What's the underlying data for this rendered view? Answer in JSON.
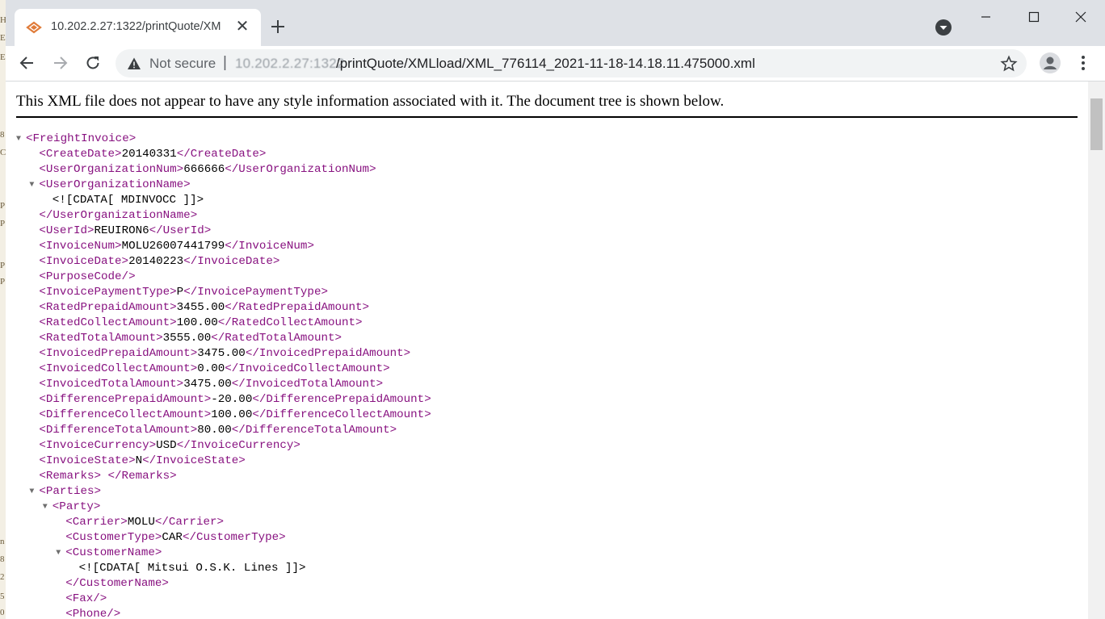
{
  "tab": {
    "title": "10.202.2.27:1322/printQuote/XM"
  },
  "address": {
    "security": "Not secure",
    "host": "10.202.2.27:1322",
    "path": "/printQuote/XMLload/XML_776114_2021-11-18-14.18.11.475000.xml"
  },
  "notice": "This XML file does not appear to have any style information associated with it. The document tree is shown below.",
  "bg_strip": [
    "H",
    "E",
    "E",
    "8",
    "C",
    "P",
    "P",
    "P",
    "P",
    "n",
    "8",
    "2",
    "5",
    "0"
  ],
  "xml_lines": [
    {
      "indent": 0,
      "toggle": true,
      "open": "<FreightInvoice>",
      "text": "",
      "close": ""
    },
    {
      "indent": 1,
      "toggle": false,
      "open": "<CreateDate>",
      "text": "20140331",
      "close": "</CreateDate>"
    },
    {
      "indent": 1,
      "toggle": false,
      "open": "<UserOrganizationNum>",
      "text": "666666",
      "close": "</UserOrganizationNum>"
    },
    {
      "indent": 1,
      "toggle": true,
      "open": "<UserOrganizationName>",
      "text": "",
      "close": ""
    },
    {
      "indent": 2,
      "toggle": false,
      "open": "",
      "text": "<![CDATA[ MDINVOCC ]]>",
      "close": ""
    },
    {
      "indent": 1,
      "toggle": false,
      "open": "",
      "text": "",
      "close": "</UserOrganizationName>"
    },
    {
      "indent": 1,
      "toggle": false,
      "open": "<UserId>",
      "text": "REUIRON6",
      "close": "</UserId>"
    },
    {
      "indent": 1,
      "toggle": false,
      "open": "<InvoiceNum>",
      "text": "MOLU26007441799",
      "close": "</InvoiceNum>"
    },
    {
      "indent": 1,
      "toggle": false,
      "open": "<InvoiceDate>",
      "text": "20140223",
      "close": "</InvoiceDate>"
    },
    {
      "indent": 1,
      "toggle": false,
      "open": "<PurposeCode/>",
      "text": "",
      "close": ""
    },
    {
      "indent": 1,
      "toggle": false,
      "open": "<InvoicePaymentType>",
      "text": "P",
      "close": "</InvoicePaymentType>"
    },
    {
      "indent": 1,
      "toggle": false,
      "open": "<RatedPrepaidAmount>",
      "text": "3455.00",
      "close": "</RatedPrepaidAmount>"
    },
    {
      "indent": 1,
      "toggle": false,
      "open": "<RatedCollectAmount>",
      "text": "100.00",
      "close": "</RatedCollectAmount>"
    },
    {
      "indent": 1,
      "toggle": false,
      "open": "<RatedTotalAmount>",
      "text": "3555.00",
      "close": "</RatedTotalAmount>"
    },
    {
      "indent": 1,
      "toggle": false,
      "open": "<InvoicedPrepaidAmount>",
      "text": "3475.00",
      "close": "</InvoicedPrepaidAmount>"
    },
    {
      "indent": 1,
      "toggle": false,
      "open": "<InvoicedCollectAmount>",
      "text": "0.00",
      "close": "</InvoicedCollectAmount>"
    },
    {
      "indent": 1,
      "toggle": false,
      "open": "<InvoicedTotalAmount>",
      "text": "3475.00",
      "close": "</InvoicedTotalAmount>"
    },
    {
      "indent": 1,
      "toggle": false,
      "open": "<DifferencePrepaidAmount>",
      "text": "-20.00",
      "close": "</DifferencePrepaidAmount>"
    },
    {
      "indent": 1,
      "toggle": false,
      "open": "<DifferenceCollectAmount>",
      "text": "100.00",
      "close": "</DifferenceCollectAmount>"
    },
    {
      "indent": 1,
      "toggle": false,
      "open": "<DifferenceTotalAmount>",
      "text": "80.00",
      "close": "</DifferenceTotalAmount>"
    },
    {
      "indent": 1,
      "toggle": false,
      "open": "<InvoiceCurrency>",
      "text": "USD",
      "close": "</InvoiceCurrency>"
    },
    {
      "indent": 1,
      "toggle": false,
      "open": "<InvoiceState>",
      "text": "N",
      "close": "</InvoiceState>"
    },
    {
      "indent": 1,
      "toggle": false,
      "open": "<Remarks>",
      "text": " ",
      "close": "</Remarks>"
    },
    {
      "indent": 1,
      "toggle": true,
      "open": "<Parties>",
      "text": "",
      "close": ""
    },
    {
      "indent": 2,
      "toggle": true,
      "open": "<Party>",
      "text": "",
      "close": ""
    },
    {
      "indent": 3,
      "toggle": false,
      "open": "<Carrier>",
      "text": "MOLU",
      "close": "</Carrier>"
    },
    {
      "indent": 3,
      "toggle": false,
      "open": "<CustomerType>",
      "text": "CAR",
      "close": "</CustomerType>"
    },
    {
      "indent": 3,
      "toggle": true,
      "open": "<CustomerName>",
      "text": "",
      "close": ""
    },
    {
      "indent": 4,
      "toggle": false,
      "open": "",
      "text": "<![CDATA[ Mitsui O.S.K. Lines ]]>",
      "close": ""
    },
    {
      "indent": 3,
      "toggle": false,
      "open": "",
      "text": "",
      "close": "</CustomerName>"
    },
    {
      "indent": 3,
      "toggle": false,
      "open": "<Fax/>",
      "text": "",
      "close": ""
    },
    {
      "indent": 3,
      "toggle": false,
      "open": "<Phone/>",
      "text": "",
      "close": ""
    }
  ]
}
